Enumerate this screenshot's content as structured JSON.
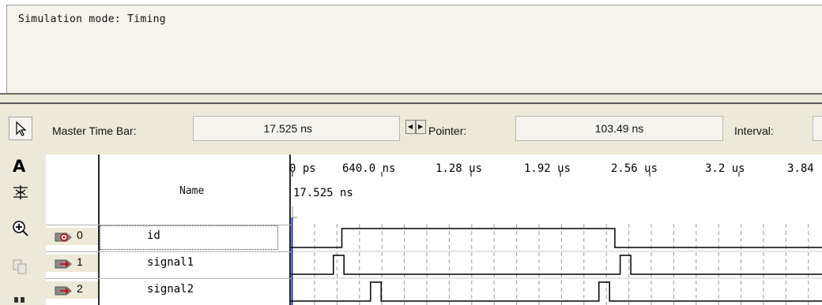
{
  "report": {
    "text": "Simulation mode: Timing"
  },
  "toolbar": {
    "master_label": "Master Time Bar:",
    "master_value": "17.525 ns",
    "pointer_label": "Pointer:",
    "pointer_value": "103.49 ns",
    "interval_label": "Interval:"
  },
  "tools": [
    "arrow-select-icon",
    "text-tool-icon",
    "waveform-edit-icon",
    "zoom-icon",
    "copy-icon",
    "find-icon"
  ],
  "table": {
    "name_header": "Name"
  },
  "ruler": {
    "ticks": [
      "0 ps",
      "640.0 ns",
      "1.28 us",
      "1.92 us",
      "2.56 us",
      "3.2 us",
      "3.84"
    ],
    "cursor_label": "17.525 ns"
  },
  "signals": [
    {
      "index": "0",
      "name": "id",
      "io": "output",
      "waveform": [
        [
          0,
          0
        ],
        [
          0.096,
          1
        ],
        [
          0.61,
          0
        ],
        [
          1,
          0
        ]
      ]
    },
    {
      "index": "1",
      "name": "signal1",
      "io": "input",
      "waveform": [
        [
          0,
          0
        ],
        [
          0.08,
          1
        ],
        [
          0.1,
          0
        ],
        [
          0.6,
          0
        ],
        [
          0.62,
          1
        ],
        [
          0.64,
          0
        ],
        [
          1,
          0
        ]
      ]
    },
    {
      "index": "2",
      "name": "signal2",
      "io": "input",
      "waveform": [
        [
          0,
          0
        ],
        [
          0.15,
          1
        ],
        [
          0.17,
          0
        ],
        [
          0.56,
          0
        ],
        [
          0.58,
          1
        ],
        [
          0.6,
          0
        ],
        [
          1,
          0
        ]
      ]
    }
  ],
  "colors": {
    "panel": "#ece9d8",
    "wave": "#000000",
    "cursor": "#1c2fbf",
    "grid": "#9a9a9a"
  }
}
